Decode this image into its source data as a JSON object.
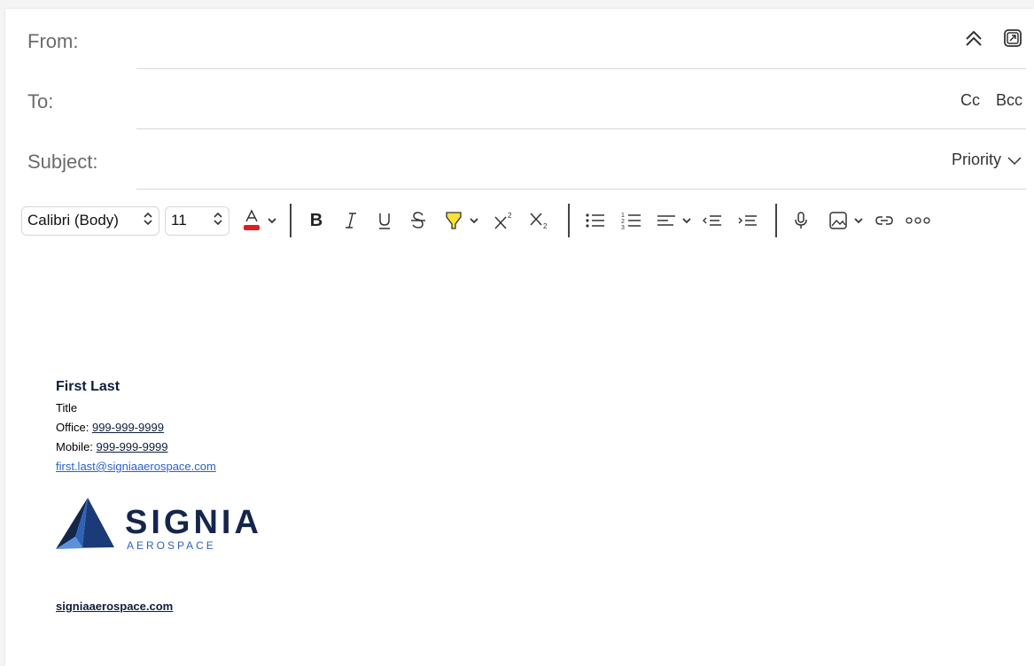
{
  "header": {
    "from_label": "From:",
    "to_label": "To:",
    "subject_label": "Subject:",
    "cc_label": "Cc",
    "bcc_label": "Bcc",
    "priority_label": "Priority",
    "collapse_icon": "chevron-double-up-icon",
    "popout_icon": "popout-icon"
  },
  "toolbar": {
    "font_name": "Calibri (Body)",
    "font_size": "11",
    "font_color": "#e01e1e",
    "highlight_color": "#f5e33a",
    "buttons": [
      "font-color",
      "bold",
      "italic",
      "underline",
      "strikethrough",
      "highlight",
      "superscript",
      "subscript",
      "bullet-list",
      "numbered-list",
      "align",
      "decrease-indent",
      "increase-indent",
      "dictate",
      "insert-picture",
      "insert-link",
      "more"
    ]
  },
  "signature": {
    "name": "First Last",
    "title": "Title",
    "office_label": "Office:",
    "office_phone": "999-999-9999",
    "mobile_label": "Mobile:",
    "mobile_phone": "999-999-9999",
    "email": "first.last@signiaaerospace.com",
    "logo_word": "SIGNIA",
    "logo_sub": "AEROSPACE",
    "website": "signiaaerospace.com",
    "brand_color": "#14264a",
    "accent_color": "#2e63b8"
  }
}
